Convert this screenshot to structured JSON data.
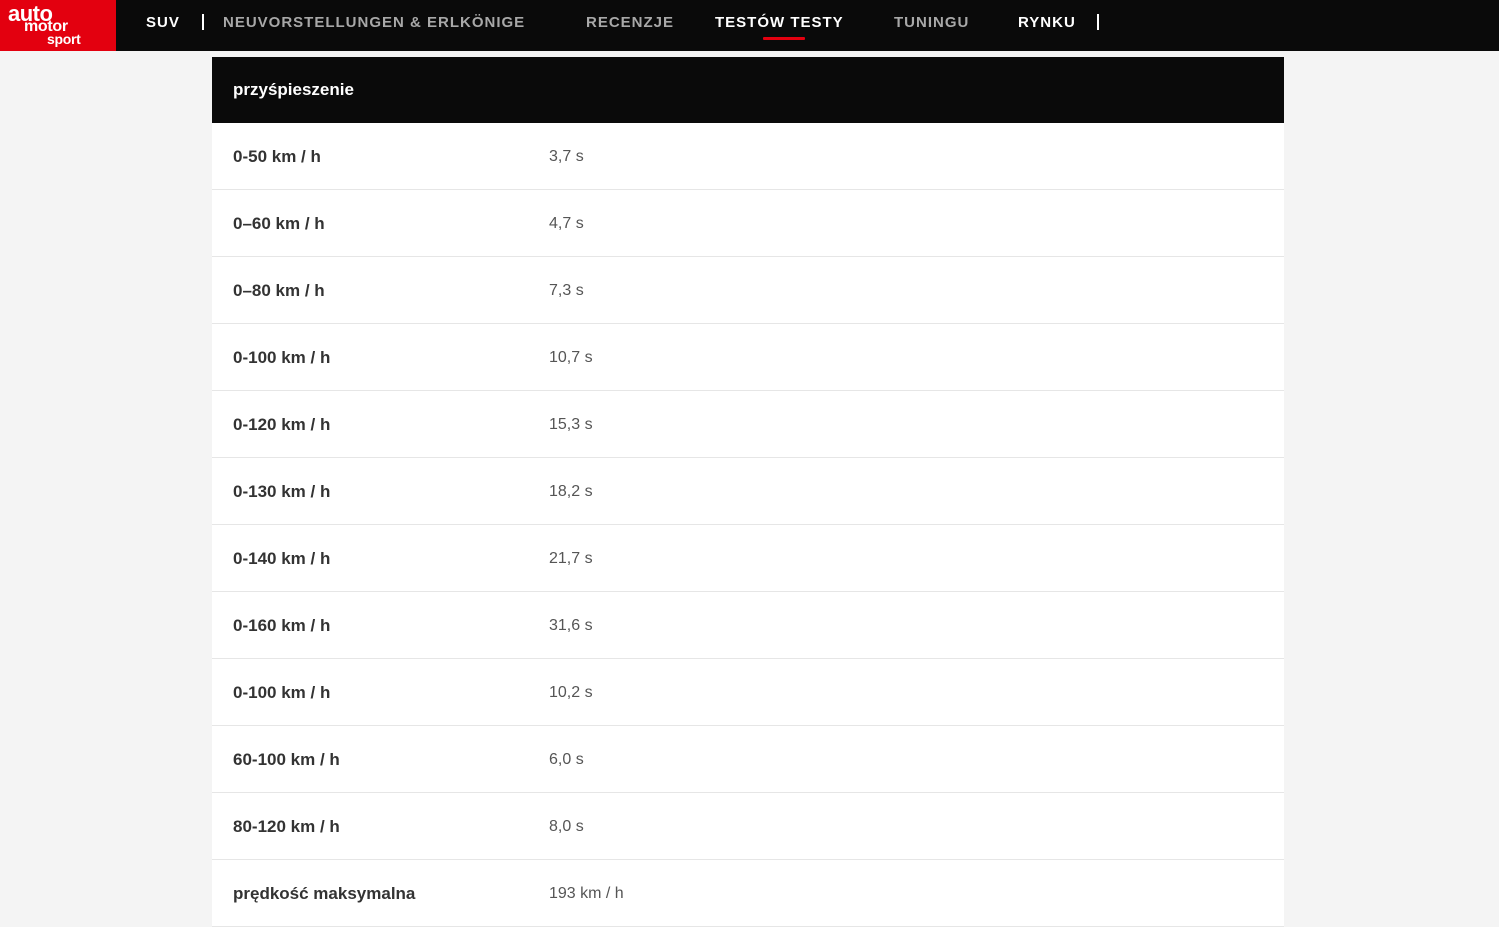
{
  "logo": {
    "line1": "auto",
    "line2": "motor",
    "line3": "sport"
  },
  "nav": {
    "items": [
      {
        "label": "SUV"
      },
      {
        "label": "NEUVORSTELLUNGEN & ERLKÖNIGE"
      },
      {
        "label": "RECENZJE"
      },
      {
        "label": "TESTÓW TESTY"
      },
      {
        "label": "TUNINGU"
      },
      {
        "label": "RYNKU"
      }
    ],
    "active_index": 3
  },
  "colors": {
    "brand_red": "#e3000f",
    "header_black": "#0a0a0a"
  },
  "table": {
    "header": "przyśpieszenie",
    "rows": [
      {
        "label": "0-50 km / h",
        "value": "3,7 s"
      },
      {
        "label": "0–60 km / h",
        "value": "4,7 s"
      },
      {
        "label": "0–80 km / h",
        "value": "7,3 s"
      },
      {
        "label": "0-100 km / h",
        "value": "10,7 s"
      },
      {
        "label": "0-120 km / h",
        "value": "15,3 s"
      },
      {
        "label": "0-130 km / h",
        "value": "18,2 s"
      },
      {
        "label": "0-140 km / h",
        "value": "21,7 s"
      },
      {
        "label": "0-160 km / h",
        "value": "31,6 s"
      },
      {
        "label": "0-100 km / h",
        "value": "10,2 s"
      },
      {
        "label": "60-100 km / h",
        "value": "6,0 s"
      },
      {
        "label": "80-120 km / h",
        "value": "8,0 s"
      },
      {
        "label": "prędkość maksymalna",
        "value": "193 km / h"
      }
    ]
  }
}
